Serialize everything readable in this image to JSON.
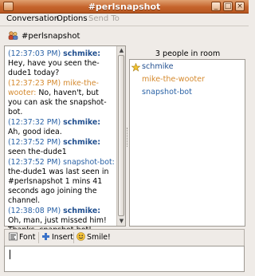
{
  "window": {
    "title": "#perlsnapshot",
    "controls": [
      "_",
      "□",
      "×"
    ]
  },
  "menubar": {
    "items": [
      {
        "label": "Conversation",
        "enabled": true
      },
      {
        "label": "Options",
        "enabled": true
      },
      {
        "label": "Send To",
        "enabled": false
      }
    ]
  },
  "header": {
    "room_title": "#perlsnapshot",
    "icon": "chat-room-icon"
  },
  "conversation": {
    "messages": [
      {
        "time": "(12:37:03 PM)",
        "nick": "schmike:",
        "text": "Hey, have you seen the-dude1 today?",
        "kind": "self"
      },
      {
        "time": "(12:37:23 PM)",
        "nick": "mike-the-wooter:",
        "text": "No, haven't, but you can ask the snapshot-bot.",
        "kind": "other"
      },
      {
        "time": "(12:37:32 PM)",
        "nick": "schmike:",
        "text": "Ah, good idea.",
        "kind": "self"
      },
      {
        "time": "(12:37:52 PM)",
        "nick": "schmike:",
        "text": "seen the-dude1",
        "kind": "self"
      },
      {
        "time": "(12:37:52 PM)",
        "nick": "snapshot-bot:",
        "text": "the-dude1 was last seen in #perlsnapshot 1 mins 41 seconds ago joining the channel.",
        "kind": "bot"
      },
      {
        "time": "(12:38:08 PM)",
        "nick": "schmike:",
        "text": "Oh, man, just missed him! Thanks, snapshot-bot!",
        "kind": "self"
      }
    ]
  },
  "room": {
    "count_label": "3 people in room",
    "users": [
      {
        "name": "schmike",
        "color": "#1f4e8f",
        "icon": "op-star-icon"
      },
      {
        "name": "mike-the-wooter",
        "color": "#d58a2f",
        "icon": ""
      },
      {
        "name": "snapshot-bot",
        "color": "#2a62a6",
        "icon": ""
      }
    ]
  },
  "toolbar": {
    "font_label": "Font",
    "insert_label": "Insert",
    "smile_label": "Smile!"
  },
  "input": {
    "value": ""
  },
  "colors": {
    "titlebar": "#c5642c",
    "self_nick": "#1f4e8f",
    "other_nick": "#d58a2f",
    "bot_nick": "#2a62a6"
  }
}
